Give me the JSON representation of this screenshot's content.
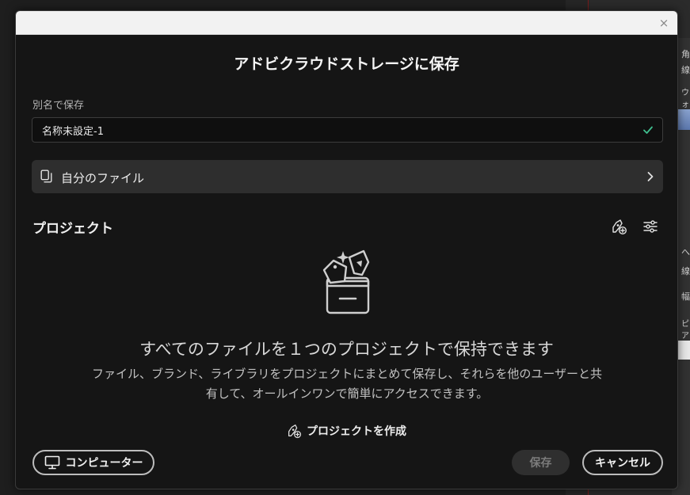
{
  "background_app": {
    "labels": [
      "角",
      "線",
      "ウォ",
      "へ",
      "線",
      "幅",
      "ピア"
    ]
  },
  "dialog": {
    "close_glyph": "×",
    "title": "アドビクラウドストレージに保存",
    "save_as": {
      "label": "別名で保存",
      "value": "名称未設定-1"
    },
    "location": {
      "label": "自分のファイル"
    },
    "projects": {
      "title": "プロジェクト",
      "empty_heading": "すべてのファイルを１つのプロジェクトで保持できます",
      "empty_description": "ファイル、ブランド、ライブラリをプロジェクトにまとめて保存し、それらを他のユーザーと共有して、オールインワンで簡単にアクセスできます。",
      "create_label": "プロジェクトを作成"
    },
    "footer": {
      "computer_label": "コンピューター",
      "save_label": "保存",
      "cancel_label": "キャンセル"
    }
  },
  "colors": {
    "dialog_bg": "#151515",
    "check": "#3fbf8f",
    "save_disabled_text": "#7c7c7c"
  }
}
